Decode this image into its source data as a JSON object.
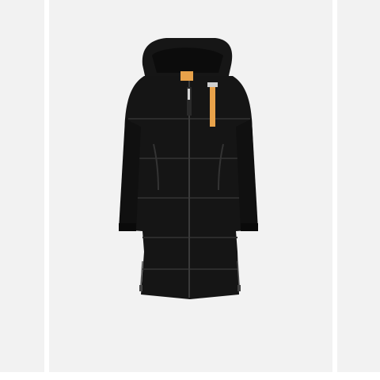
{
  "gallery": {
    "product_image_alt": "",
    "zoom_button_label": "",
    "icons": {
      "zoom": "search-magnifier-icon"
    }
  },
  "colors": {
    "background": "#ffffff",
    "image_bg": "#f2f2f2",
    "jacket": "#141414",
    "accent_strap": "#e8a24a"
  }
}
